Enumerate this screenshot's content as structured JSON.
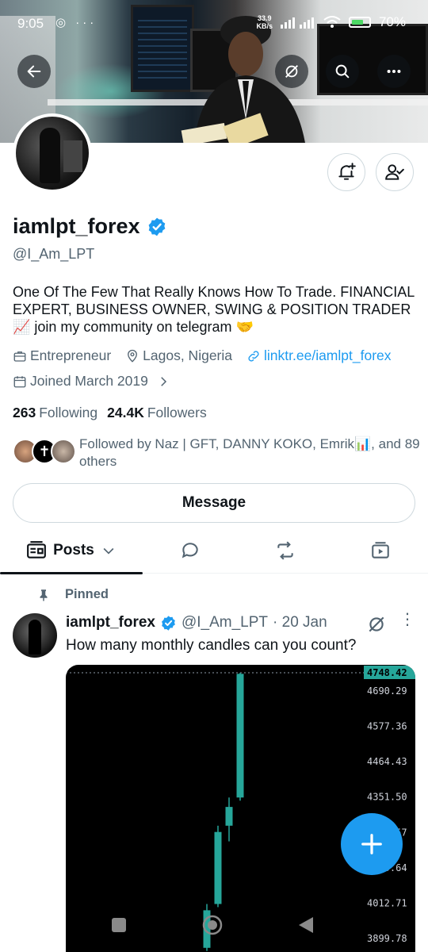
{
  "status_bar": {
    "time": "9:05",
    "speed_top": "33.9",
    "speed_unit": "KB/s",
    "battery": "70%"
  },
  "profile": {
    "name": "iamlpt_forex",
    "handle": "@I_Am_LPT",
    "bio": "One Of The Few That Really Knows How To Trade. FINANCIAL EXPERT, BUSINESS OWNER, SWING & POSITION TRADER📈 join my community on telegram 🤝",
    "category": "Entrepreneur",
    "location": "Lagos, Nigeria",
    "website": "linktr.ee/iamlpt_forex",
    "joined": "Joined March 2019",
    "following_count": "263",
    "following_label": "Following",
    "followers_count": "24.4K",
    "followers_label": "Followers",
    "followed_by": "Followed by Naz | GFT, DANNY KOKO, Emrik📊, and 89 others",
    "message_label": "Message"
  },
  "tabs": {
    "posts_label": "Posts"
  },
  "post": {
    "pinned_label": "Pinned",
    "author": "iamlpt_forex",
    "handle": "@I_Am_LPT",
    "date": "· 20 Jan",
    "text": "How many monthly candles can you count?"
  },
  "chart_data": {
    "type": "candlestick",
    "price_axis_labels": [
      "4748.42",
      "4690.29",
      "4577.36",
      "4464.43",
      "4351.50",
      "4238.57",
      "4125.64",
      "4012.71",
      "3899.78"
    ],
    "current_price": "4748.42",
    "colors": {
      "up": "#26a69a",
      "price_tag": "#26a69a",
      "background": "#000000"
    },
    "candles": [
      {
        "open": 3870,
        "close": 3990,
        "high": 4010,
        "low": 3860
      },
      {
        "open": 4010,
        "close": 4240,
        "high": 4260,
        "low": 4000
      },
      {
        "open": 4260,
        "close": 4320,
        "high": 4350,
        "low": 4210
      },
      {
        "open": 4350,
        "close": 4745,
        "high": 4748,
        "low": 4340
      }
    ]
  },
  "colors": {
    "accent": "#1d9bf0",
    "text_secondary": "#536471"
  }
}
